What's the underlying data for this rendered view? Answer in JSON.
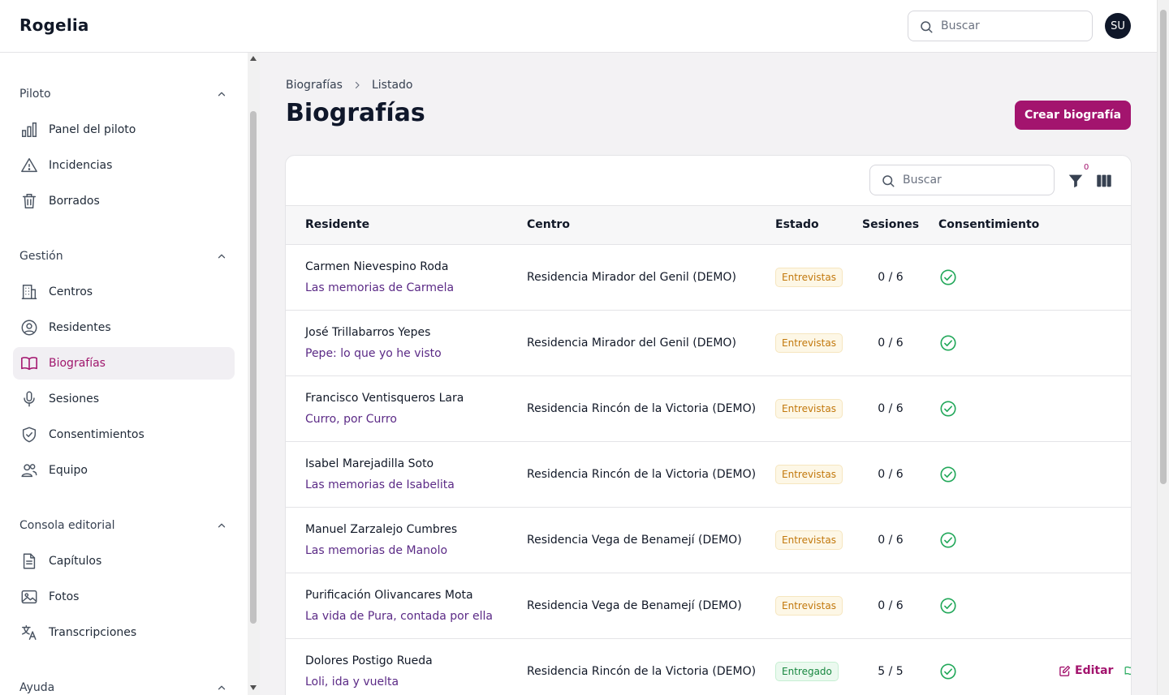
{
  "app": {
    "brand": "Rogelia"
  },
  "header": {
    "search_placeholder": "Buscar",
    "avatar_initials": "SU"
  },
  "sidebar": {
    "groups": [
      {
        "label": "Piloto",
        "items": [
          {
            "label": "Panel del piloto",
            "icon": "bar-chart-icon"
          },
          {
            "label": "Incidencias",
            "icon": "warning-icon"
          },
          {
            "label": "Borrados",
            "icon": "trash-icon"
          }
        ]
      },
      {
        "label": "Gestión",
        "items": [
          {
            "label": "Centros",
            "icon": "building-icon"
          },
          {
            "label": "Residentes",
            "icon": "user-circle-icon"
          },
          {
            "label": "Biografías",
            "icon": "book-icon",
            "active": true
          },
          {
            "label": "Sesiones",
            "icon": "microphone-icon"
          },
          {
            "label": "Consentimientos",
            "icon": "shield-check-icon"
          },
          {
            "label": "Equipo",
            "icon": "users-icon"
          }
        ]
      },
      {
        "label": "Consola editorial",
        "items": [
          {
            "label": "Capítulos",
            "icon": "document-icon"
          },
          {
            "label": "Fotos",
            "icon": "photo-icon"
          },
          {
            "label": "Transcripciones",
            "icon": "translate-icon"
          }
        ]
      },
      {
        "label": "Ayuda",
        "items": []
      }
    ]
  },
  "breadcrumb": {
    "items": [
      "Biografías",
      "Listado"
    ]
  },
  "page": {
    "title": "Biografías",
    "create_button": "Crear biografía"
  },
  "table": {
    "search_placeholder": "Buscar",
    "filter_count": "0",
    "columns": [
      "Residente",
      "Centro",
      "Estado",
      "Sesiones",
      "Consentimiento"
    ],
    "rows": [
      {
        "resident": "Carmen Nievespino Roda",
        "title": "Las memorias de Carmela",
        "centro": "Residencia Mirador del Genil (DEMO)",
        "estado": "Entrevistas",
        "sesiones": "0 / 6",
        "consent": true
      },
      {
        "resident": "José Trillabarros Yepes",
        "title": "Pepe: lo que yo he visto",
        "centro": "Residencia Mirador del Genil (DEMO)",
        "estado": "Entrevistas",
        "sesiones": "0 / 6",
        "consent": true
      },
      {
        "resident": "Francisco Ventisqueros Lara",
        "title": "Curro, por Curro",
        "centro": "Residencia Rincón de la Victoria (DEMO)",
        "estado": "Entrevistas",
        "sesiones": "0 / 6",
        "consent": true
      },
      {
        "resident": "Isabel Marejadilla Soto",
        "title": "Las memorias de Isabelita",
        "centro": "Residencia Rincón de la Victoria (DEMO)",
        "estado": "Entrevistas",
        "sesiones": "0 / 6",
        "consent": true
      },
      {
        "resident": "Manuel Zarzalejo Cumbres",
        "title": "Las memorias de Manolo",
        "centro": "Residencia Vega de Benamejí (DEMO)",
        "estado": "Entrevistas",
        "sesiones": "0 / 6",
        "consent": true
      },
      {
        "resident": "Purificación Olivancares Mota",
        "title": "La vida de Pura, contada por ella",
        "centro": "Residencia Vega de Benamejí (DEMO)",
        "estado": "Entrevistas",
        "sesiones": "0 / 6",
        "consent": true
      },
      {
        "resident": "Dolores Postigo Rueda",
        "title": "Loli, ida y vuelta",
        "centro": "Residencia Rincón de la Victoria (DEMO)",
        "estado": "Entregado",
        "sesiones": "5 / 5",
        "consent": true,
        "edit_label": "Editar"
      }
    ]
  },
  "colors": {
    "accent": "#a3146e",
    "title_link": "#5b2a86",
    "status_entrevistas": "#c2780c",
    "status_entregado": "#17873f",
    "consent_ok": "#22a85a"
  }
}
